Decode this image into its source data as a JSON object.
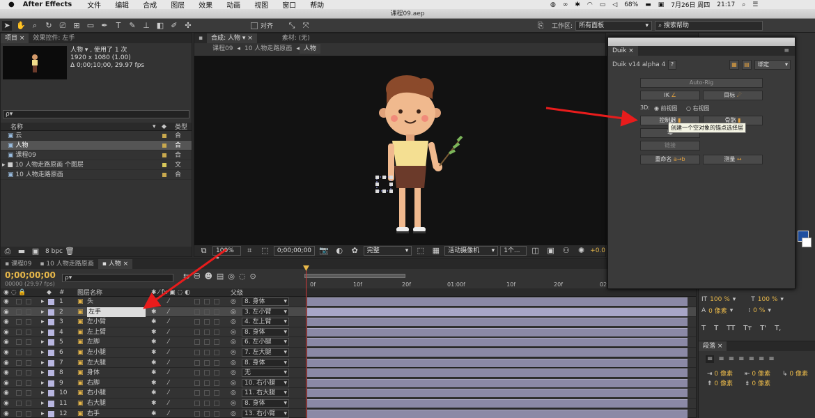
{
  "menubar": {
    "app": "After Effects",
    "items": [
      "文件",
      "编辑",
      "合成",
      "图层",
      "效果",
      "动画",
      "视图",
      "窗口",
      "帮助"
    ],
    "battery": "68%",
    "date": "7月26日 周四",
    "time": "21:17"
  },
  "window": {
    "title": "课程09.aep"
  },
  "toolbar": {
    "align_label": "对齐",
    "workspace_label": "工作区:",
    "workspace_value": "所有面板",
    "search_placeholder": "搜索帮助"
  },
  "project": {
    "tab": "项目",
    "effects_tab": "效果控件: 左手",
    "comp_name": "人物 ▾ , 使用了 1 次",
    "comp_size": "1920 x 1080 (1.00)",
    "comp_duration": "Δ 0;00;10;00, 29.97 fps",
    "search_placeholder": "ρ▾",
    "col_name": "名称",
    "col_type": "类型",
    "items": [
      {
        "name": "云",
        "type": "合"
      },
      {
        "name": "人物",
        "type": "合"
      },
      {
        "name": "课程09",
        "type": "合"
      },
      {
        "name": "10 人物走路原画 个图层",
        "type": "文"
      },
      {
        "name": "10 人物走路原画",
        "type": "合"
      }
    ],
    "bpc": "8 bpc"
  },
  "viewer": {
    "comp_tab": "合成: 人物",
    "footage_tab": "素材: (无)",
    "crumbs": [
      "课程09",
      "10 人物走路原画",
      "人物"
    ],
    "zoom": "100%",
    "timecode": "0;00;00;00",
    "quality": "完整",
    "camera": "活动摄像机",
    "views": "1个...",
    "offset": "+0.0"
  },
  "timeline": {
    "tabs": [
      "课程09",
      "10 人物走路原画",
      "人物"
    ],
    "timecode": "0;00;00;00",
    "fps": "00000 (29.97 fps)",
    "col_hash": "#",
    "col_name": "图层名称",
    "col_parent": "父级",
    "ruler": [
      "0f",
      "10f",
      "20f",
      "01:00f",
      "10f",
      "20f",
      "02"
    ],
    "layers": [
      {
        "num": "1",
        "name": "头",
        "parent": "8. 身体"
      },
      {
        "num": "2",
        "name": "左手",
        "parent": "3. 左小臂"
      },
      {
        "num": "3",
        "name": "左小臂",
        "parent": "4. 左上臂"
      },
      {
        "num": "4",
        "name": "左上臂",
        "parent": "8. 身体"
      },
      {
        "num": "5",
        "name": "左脚",
        "parent": "6. 左小腿"
      },
      {
        "num": "6",
        "name": "左小腿",
        "parent": "7. 左大腿"
      },
      {
        "num": "7",
        "name": "左大腿",
        "parent": "8. 身体"
      },
      {
        "num": "8",
        "name": "身体",
        "parent": "无"
      },
      {
        "num": "9",
        "name": "右脚",
        "parent": "10. 右小腿"
      },
      {
        "num": "10",
        "name": "右小腿",
        "parent": "11. 右大腿"
      },
      {
        "num": "11",
        "name": "右大腿",
        "parent": "8. 身体"
      },
      {
        "num": "12",
        "name": "右手",
        "parent": "13. 右小臂"
      }
    ]
  },
  "duik": {
    "tab": "Duik",
    "version": "Duik v14 alpha 4",
    "help": "?",
    "bind_label": "绑定",
    "autorig": "Auto-Rig",
    "ik": "IK",
    "goal": "目标",
    "view_3d": "3D:",
    "front_view": "前视图",
    "right_view": "右视图",
    "controller": "控制器",
    "bone": "骨骼",
    "zero": "零",
    "link": "链接",
    "rename": "重命名",
    "rename_icon": "a→b",
    "measure": "测量",
    "tooltip": "创建一个空对象的锚点选择层"
  },
  "character": {
    "scale_v": "100 %",
    "scale_h": "100 %",
    "baseline": "0 像素",
    "tsume": "0 %",
    "styles": [
      "T",
      "T",
      "TT",
      "Tт",
      "T'",
      "T,"
    ]
  },
  "paragraph": {
    "tab": "段落",
    "indent_values": [
      "0 像素",
      "0 像素",
      "0 像素",
      "0 像素",
      "0 像素"
    ]
  },
  "colors": {
    "accent": "#e8b84a",
    "bar": "#8b89a6",
    "arrow": "#e81c1c",
    "playhead": "#d43a3a"
  }
}
